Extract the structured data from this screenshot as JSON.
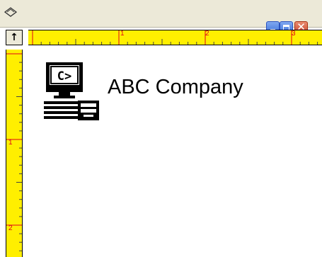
{
  "window": {
    "icon": "pen-icon",
    "buttons": [
      "minimize",
      "maximize",
      "close"
    ],
    "close_glyph": "✕"
  },
  "ruler_corner": {
    "icon": "arrow-up-icon",
    "glyph": "↑"
  },
  "horizontal_ruler": {
    "numbers": [
      "1",
      "2",
      "3"
    ],
    "color": "#ffef00",
    "number_color": "#e0001a"
  },
  "vertical_ruler": {
    "numbers": [
      "1",
      "2"
    ]
  },
  "document": {
    "logo": {
      "icon": "computer-icon",
      "screen_text": "C>"
    },
    "company_name": "ABC Company"
  }
}
